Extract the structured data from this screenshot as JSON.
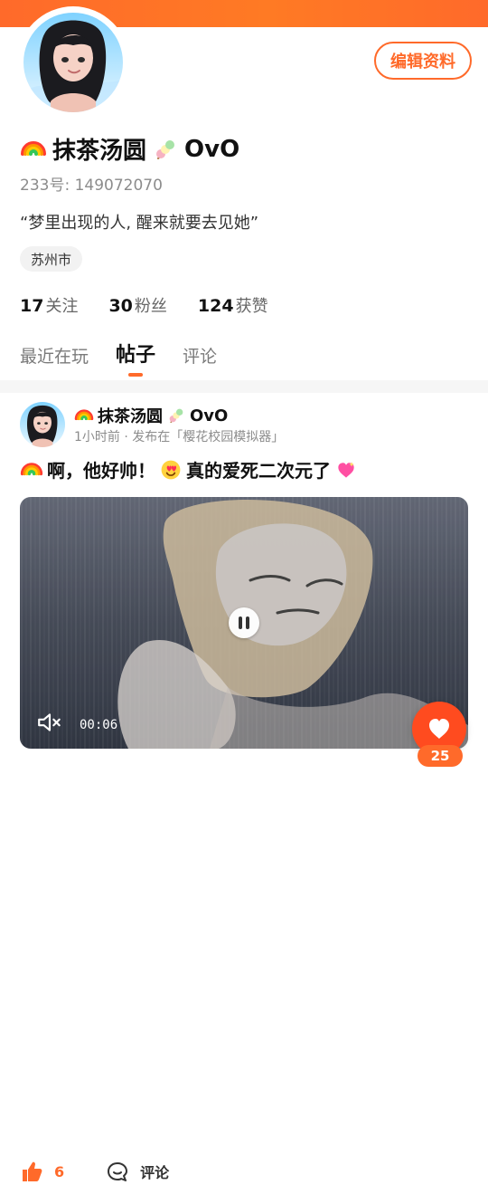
{
  "profile": {
    "name": "抹茶汤圆",
    "name_suffix": "OvO",
    "uid": "233号: 149072070",
    "bio": "“梦里出现的人, 醒来就要去见她”",
    "location": "苏州市",
    "edit_profile_label": "编辑资料",
    "stats": [
      {
        "num": "17",
        "label": "关注"
      },
      {
        "num": "30",
        "label": "粉丝"
      },
      {
        "num": "124",
        "label": "获赞"
      }
    ]
  },
  "tabs": [
    {
      "label": "最近在玩",
      "active": false
    },
    {
      "label": "帖子",
      "active": true
    },
    {
      "label": "评论",
      "active": false
    }
  ],
  "post": {
    "author": "抹茶汤圆",
    "author_suffix": "OvO",
    "meta": "1小时前 · 发布在「樱花校园模拟器」",
    "text_1": "啊，他好帅！",
    "text_2": "真的爱死二次元了",
    "video": {
      "time": "00:06",
      "state": "playing"
    },
    "likes": "6",
    "comment_label": "评论",
    "fab_likes": "25"
  },
  "colors": {
    "accent": "#ff6a2a",
    "accent2": "#ff4b1f",
    "muted": "#8c8c8c"
  },
  "icons": {
    "top_left_emoji": "rainbow-icon",
    "name_emoji": "dango-icon",
    "post_emoji_1": "rainbow-icon",
    "post_emoji_2": "heart-eyes-icon",
    "post_emoji_3": "sparkling-heart-icon",
    "pause": "pause-icon",
    "mute": "mute-icon",
    "like": "thumbs-up-icon",
    "comment": "comment-icon",
    "fab": "heart-icon"
  }
}
